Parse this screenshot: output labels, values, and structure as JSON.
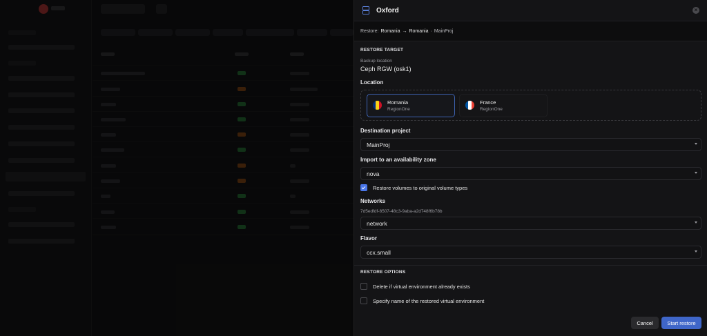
{
  "drawer": {
    "title": "Oxford",
    "breadcrumb": {
      "prefix": "Restore:",
      "from": "Romania",
      "arrow": "→",
      "to": "Romania",
      "sep": "·",
      "project": "MainProj"
    },
    "restore_target": {
      "section_title": "RESTORE TARGET",
      "backup_location_label": "Backup location",
      "backup_location_value": "Ceph RGW (osk1)",
      "location_label": "Location",
      "locations": [
        {
          "name": "Romania",
          "region": "RegionOne",
          "selected": true,
          "flag_colors": [
            "#002B7F",
            "#FCD116",
            "#CE1126"
          ]
        },
        {
          "name": "France",
          "region": "RegionOne",
          "selected": false,
          "flag_colors": [
            "#0055A4",
            "#FFFFFF",
            "#EF4135"
          ]
        }
      ],
      "destination_project_label": "Destination project",
      "destination_project_value": "MainProj",
      "availability_zone_label": "Import to an availability zone",
      "availability_zone_value": "nova",
      "restore_volumes_label": "Restore volumes to original volume types",
      "restore_volumes_checked": true,
      "networks_label": "Networks",
      "network_id": "7d5edfdf-8507-48c3-9aba-a2d748f6b78b",
      "network_value": "network",
      "flavor_label": "Flavor",
      "flavor_value": "ccx.small"
    },
    "restore_options": {
      "section_title": "RESTORE OPTIONS",
      "delete_if_exists_label": "Delete if virtual environment already exists",
      "delete_if_exists_checked": false,
      "specify_name_label": "Specify name of the restored virtual environment",
      "specify_name_checked": false
    },
    "buttons": {
      "cancel_label": "Cancel",
      "start_label": "Start restore"
    }
  },
  "colors": {
    "accent": "#3f66c9",
    "checkbox_on": "#4a76e8",
    "selected_border": "#3e63b3"
  }
}
